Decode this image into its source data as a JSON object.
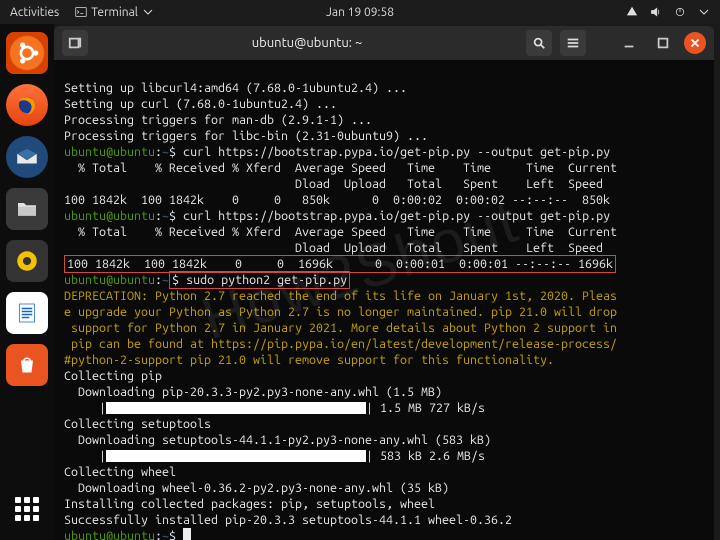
{
  "topbar": {
    "activities": "Activities",
    "app_label": "Terminal",
    "clock": "Jan 19  09:58"
  },
  "window": {
    "title": "ubuntu@ubuntu: ~"
  },
  "prompt": {
    "userhost": "ubuntu@ubuntu",
    "sep": ":",
    "path": "~",
    "sigil": "$"
  },
  "term": {
    "l01": "Setting up libcurl4:amd64 (7.68.0-1ubuntu2.4) ...",
    "l02": "Setting up curl (7.68.0-1ubuntu2.4) ...",
    "l03": "Processing triggers for man-db (2.9.1-1) ...",
    "l04": "Processing triggers for libc-bin (2.31-0ubuntu9) ...",
    "cmd1": " curl https://bootstrap.pypa.io/get-pip.py --output get-pip.py",
    "hdr1": "  % Total    % Received % Xferd  Average Speed   Time    Time     Time  Current",
    "hdr2": "                                 Dload  Upload   Total   Spent    Left  Speed",
    "row1": "100 1842k  100 1842k    0     0   850k      0  0:00:02  0:00:02 --:--:--  850k",
    "cmd2": " curl https://bootstrap.pypa.io/get-pip.py --output get-pip.py",
    "row2": "100 1842k  100 1842k    0     0  1696k      0  0:00:01  0:00:01 --:--:-- 1696k",
    "cmd3": " sudo python2 get-pip.py",
    "dep1": "DEPRECATION: Python 2.7 reached the end of its life on January 1st, 2020. Pleas",
    "dep2": "e upgrade your Python as Python 2.7 is no longer maintained. pip 21.0 will drop",
    "dep3": " support for Python 2.7 in January 2021. More details about Python 2 support in",
    "dep4": " pip can be found at https://pip.pypa.io/en/latest/development/release-process/",
    "dep5": "#python-2-support pip 21.0 will remove support for this functionality.",
    "col_pip": "Collecting pip",
    "dl_pip": "  Downloading pip-20.3.3-py2.py3-none-any.whl (1.5 MB)",
    "bar_pip_suffix": " 1.5 MB 727 kB/s",
    "col_st": "Collecting setuptools",
    "dl_st": "  Downloading setuptools-44.1.1-py2.py3-none-any.whl (583 kB)",
    "bar_st_suffix": " 583 kB 2.6 MB/s",
    "col_wh": "Collecting wheel",
    "dl_wh": "  Downloading wheel-0.36.2-py2.py3-none-any.whl (35 kB)",
    "inst": "Installing collected packages: pip, setuptools, wheel",
    "succ": "Successfully installed pip-20.3.3 setuptools-44.1.1 wheel-0.36.2"
  },
  "watermark": "How2Shout"
}
